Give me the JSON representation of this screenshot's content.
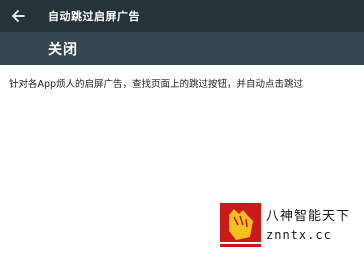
{
  "appbar": {
    "back_icon": "arrow-left-icon",
    "title": "自动跳过启屏广告"
  },
  "toolbar": {
    "close_label": "关闭"
  },
  "content": {
    "description": "针对各App烦人的启屏广告，查找页面上的跳过按钮，并自动点击跳过"
  },
  "watermark": {
    "logo_icon": "hand-logo-icon",
    "title": "八神智能天下",
    "url": "znntx.cc"
  },
  "colors": {
    "appbar_bg": "#26343a",
    "toolbar_bg": "#35484f",
    "logo_red": "#cc1a1a",
    "logo_yellow": "#f2c21b"
  }
}
